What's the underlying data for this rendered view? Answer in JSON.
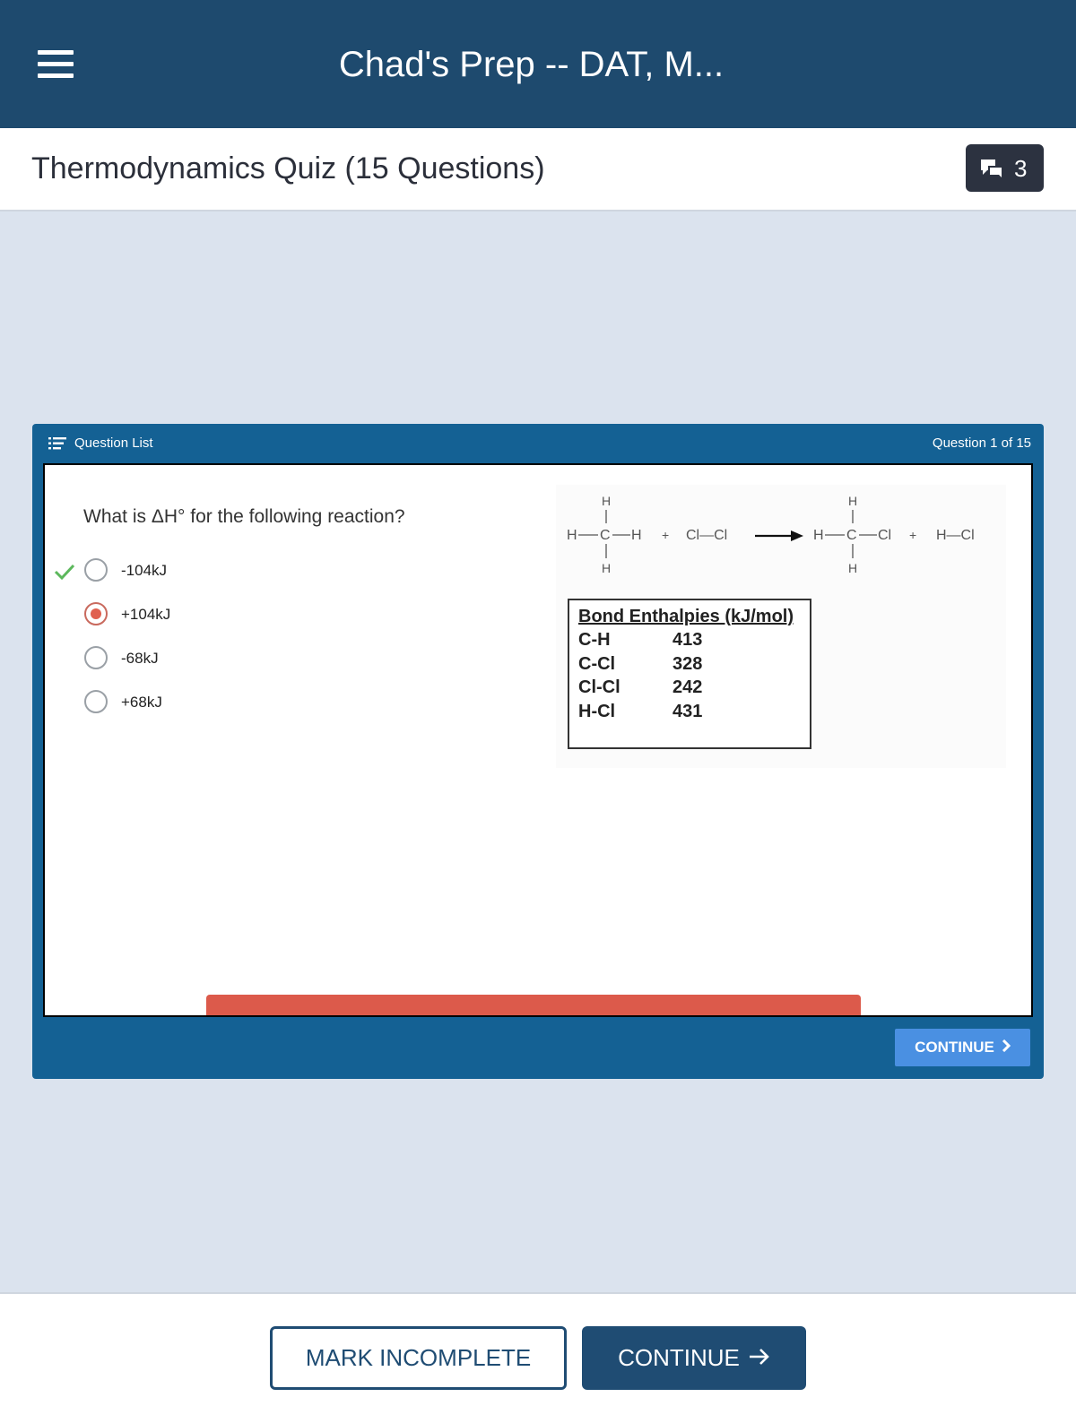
{
  "app": {
    "title": "Chad's Prep -- DAT, M..."
  },
  "lesson": {
    "title": "Thermodynamics Quiz (15 Questions)",
    "comment_count": "3"
  },
  "quiz": {
    "question_list_label": "Question List",
    "question_counter": "Question 1 of 15",
    "question_text": "What is ΔH° for the following reaction?",
    "options": [
      {
        "label": "-104kJ",
        "selected": false,
        "correct": true
      },
      {
        "label": "+104kJ",
        "selected": true,
        "correct": false
      },
      {
        "label": "-68kJ",
        "selected": false,
        "correct": false
      },
      {
        "label": "+68kJ",
        "selected": false,
        "correct": false
      }
    ],
    "reaction": {
      "h": "H",
      "c": "C",
      "cl2": "Cl—Cl",
      "cl": "Cl",
      "hcl": "H—Cl",
      "plus": "+"
    },
    "bond_table": {
      "title": "Bond Enthalpies (kJ/mol)",
      "rows": [
        {
          "bond": "C-H",
          "value": "413"
        },
        {
          "bond": "C-Cl",
          "value": "328"
        },
        {
          "bond": "Cl-Cl",
          "value": "242"
        },
        {
          "bond": "H-Cl",
          "value": "431"
        }
      ]
    },
    "continue_label": "CONTINUE",
    "progress_color": "#dc5a4b"
  },
  "footer": {
    "mark_incomplete_label": "MARK INCOMPLETE",
    "continue_label": "CONTINUE"
  },
  "colors": {
    "header": "#1e4a6e",
    "frame": "#146194",
    "background": "#dbe3ee",
    "accent": "#4a90e2",
    "selected": "#e0604f",
    "correct": "#5cb85c"
  }
}
